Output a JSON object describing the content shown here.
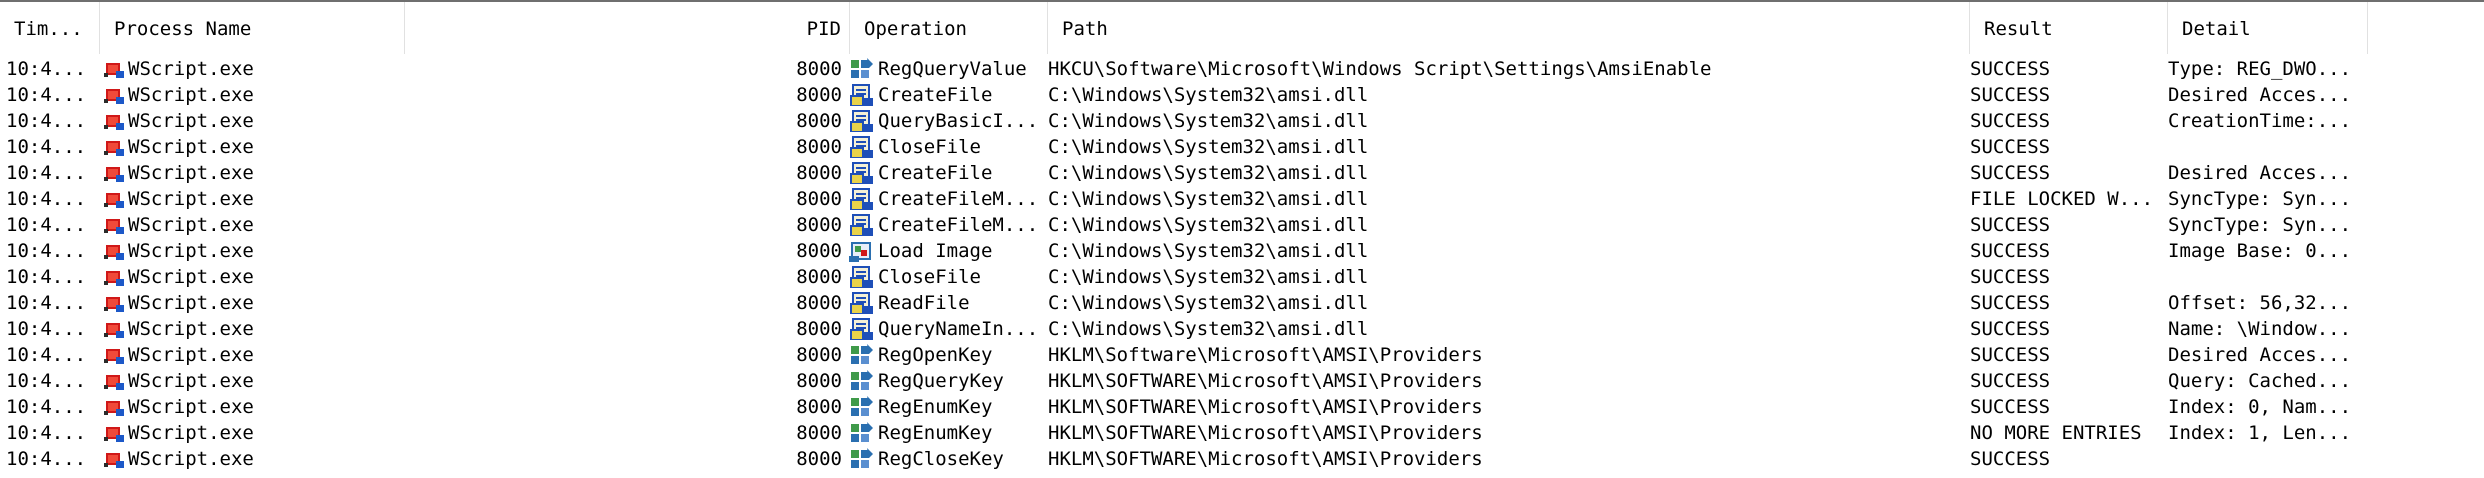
{
  "columns": {
    "time": "Tim...",
    "process": "Process Name",
    "pid": "PID",
    "operation": "Operation",
    "path": "Path",
    "result": "Result",
    "detail": "Detail"
  },
  "rows": [
    {
      "time": "10:4...",
      "process": "WScript.exe",
      "pid": "8000",
      "operation": "RegQueryValue",
      "op_icon": "registry-icon",
      "path": "HKCU\\Software\\Microsoft\\Windows Script\\Settings\\AmsiEnable",
      "result": "SUCCESS",
      "detail": "Type: REG_DWO..."
    },
    {
      "time": "10:4...",
      "process": "WScript.exe",
      "pid": "8000",
      "operation": "CreateFile",
      "op_icon": "file-icon",
      "path": "C:\\Windows\\System32\\amsi.dll",
      "result": "SUCCESS",
      "detail": "Desired Acces..."
    },
    {
      "time": "10:4...",
      "process": "WScript.exe",
      "pid": "8000",
      "operation": "QueryBasicI...",
      "op_icon": "file-icon",
      "path": "C:\\Windows\\System32\\amsi.dll",
      "result": "SUCCESS",
      "detail": "CreationTime:..."
    },
    {
      "time": "10:4...",
      "process": "WScript.exe",
      "pid": "8000",
      "operation": "CloseFile",
      "op_icon": "file-icon",
      "path": "C:\\Windows\\System32\\amsi.dll",
      "result": "SUCCESS",
      "detail": ""
    },
    {
      "time": "10:4...",
      "process": "WScript.exe",
      "pid": "8000",
      "operation": "CreateFile",
      "op_icon": "file-icon",
      "path": "C:\\Windows\\System32\\amsi.dll",
      "result": "SUCCESS",
      "detail": "Desired Acces..."
    },
    {
      "time": "10:4...",
      "process": "WScript.exe",
      "pid": "8000",
      "operation": "CreateFileM...",
      "op_icon": "file-icon",
      "path": "C:\\Windows\\System32\\amsi.dll",
      "result": "FILE LOCKED W...",
      "detail": "SyncType: Syn..."
    },
    {
      "time": "10:4...",
      "process": "WScript.exe",
      "pid": "8000",
      "operation": "CreateFileM...",
      "op_icon": "file-icon",
      "path": "C:\\Windows\\System32\\amsi.dll",
      "result": "SUCCESS",
      "detail": "SyncType: Syn..."
    },
    {
      "time": "10:4...",
      "process": "WScript.exe",
      "pid": "8000",
      "operation": "Load Image",
      "op_icon": "load-image-icon",
      "path": "C:\\Windows\\System32\\amsi.dll",
      "result": "SUCCESS",
      "detail": "Image Base: 0..."
    },
    {
      "time": "10:4...",
      "process": "WScript.exe",
      "pid": "8000",
      "operation": "CloseFile",
      "op_icon": "file-icon",
      "path": "C:\\Windows\\System32\\amsi.dll",
      "result": "SUCCESS",
      "detail": ""
    },
    {
      "time": "10:4...",
      "process": "WScript.exe",
      "pid": "8000",
      "operation": "ReadFile",
      "op_icon": "file-icon",
      "path": "C:\\Windows\\System32\\amsi.dll",
      "result": "SUCCESS",
      "detail": "Offset: 56,32..."
    },
    {
      "time": "10:4...",
      "process": "WScript.exe",
      "pid": "8000",
      "operation": "QueryNameIn...",
      "op_icon": "file-icon",
      "path": "C:\\Windows\\System32\\amsi.dll",
      "result": "SUCCESS",
      "detail": "Name: \\Window..."
    },
    {
      "time": "10:4...",
      "process": "WScript.exe",
      "pid": "8000",
      "operation": "RegOpenKey",
      "op_icon": "registry-icon",
      "path": "HKLM\\Software\\Microsoft\\AMSI\\Providers",
      "result": "SUCCESS",
      "detail": "Desired Acces..."
    },
    {
      "time": "10:4...",
      "process": "WScript.exe",
      "pid": "8000",
      "operation": "RegQueryKey",
      "op_icon": "registry-icon",
      "path": "HKLM\\SOFTWARE\\Microsoft\\AMSI\\Providers",
      "result": "SUCCESS",
      "detail": "Query: Cached..."
    },
    {
      "time": "10:4...",
      "process": "WScript.exe",
      "pid": "8000",
      "operation": "RegEnumKey",
      "op_icon": "registry-icon",
      "path": "HKLM\\SOFTWARE\\Microsoft\\AMSI\\Providers",
      "result": "SUCCESS",
      "detail": "Index: 0, Nam..."
    },
    {
      "time": "10:4...",
      "process": "WScript.exe",
      "pid": "8000",
      "operation": "RegEnumKey",
      "op_icon": "registry-icon",
      "path": "HKLM\\SOFTWARE\\Microsoft\\AMSI\\Providers",
      "result": "NO MORE ENTRIES",
      "detail": "Index: 1, Len..."
    },
    {
      "time": "10:4...",
      "process": "WScript.exe",
      "pid": "8000",
      "operation": "RegCloseKey",
      "op_icon": "registry-icon",
      "path": "HKLM\\SOFTWARE\\Microsoft\\AMSI\\Providers",
      "result": "SUCCESS",
      "detail": ""
    }
  ],
  "colors": {
    "header_divider": "#e1e1e1",
    "top_border": "#6f6f6f",
    "process_icon_red": "#d01818",
    "process_icon_blue": "#1c58c8",
    "file_icon_yellow": "#e8d24a",
    "file_icon_blue": "#1e4fb8",
    "registry_icon_blue": "#2a6fb0",
    "registry_icon_green": "#3f9a4a"
  },
  "process_icon": "wscript-process-icon"
}
